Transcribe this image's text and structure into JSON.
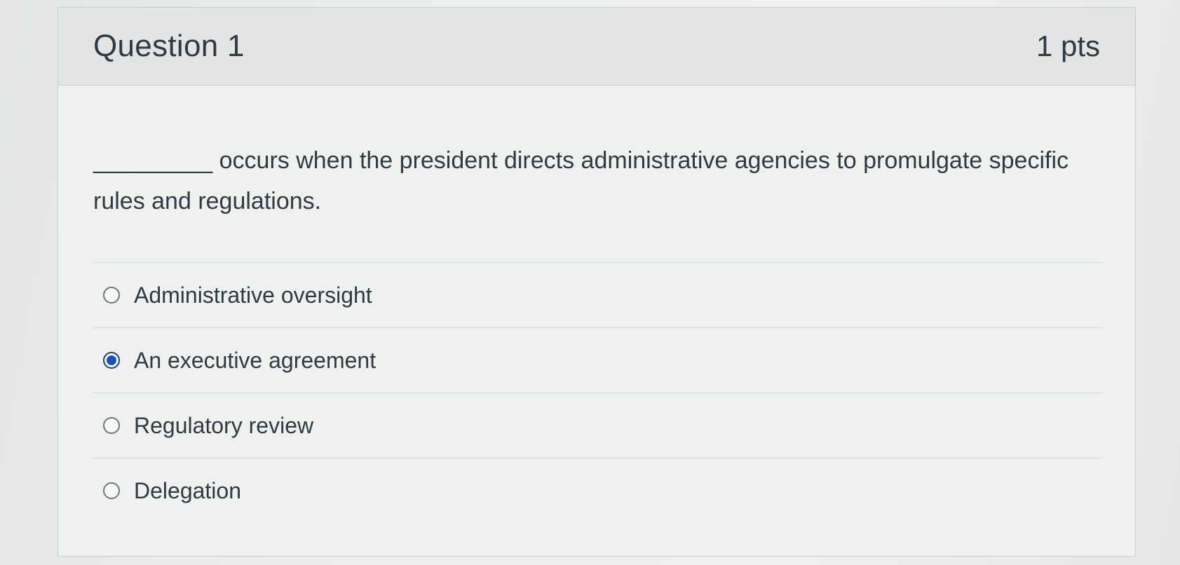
{
  "question": {
    "title": "Question 1",
    "points": "1 pts",
    "text": "_________ occurs when the president directs administrative agencies to promulgate specific rules and regulations.",
    "answers": [
      {
        "label": "Administrative oversight",
        "selected": false
      },
      {
        "label": "An executive agreement",
        "selected": true
      },
      {
        "label": "Regulatory review",
        "selected": false
      },
      {
        "label": "Delegation",
        "selected": false
      }
    ]
  },
  "colors": {
    "header_bg": "#e2e5e3",
    "text": "#2d3b45",
    "selected_radio": "#1a4fc4",
    "border": "#c7cdd1"
  }
}
